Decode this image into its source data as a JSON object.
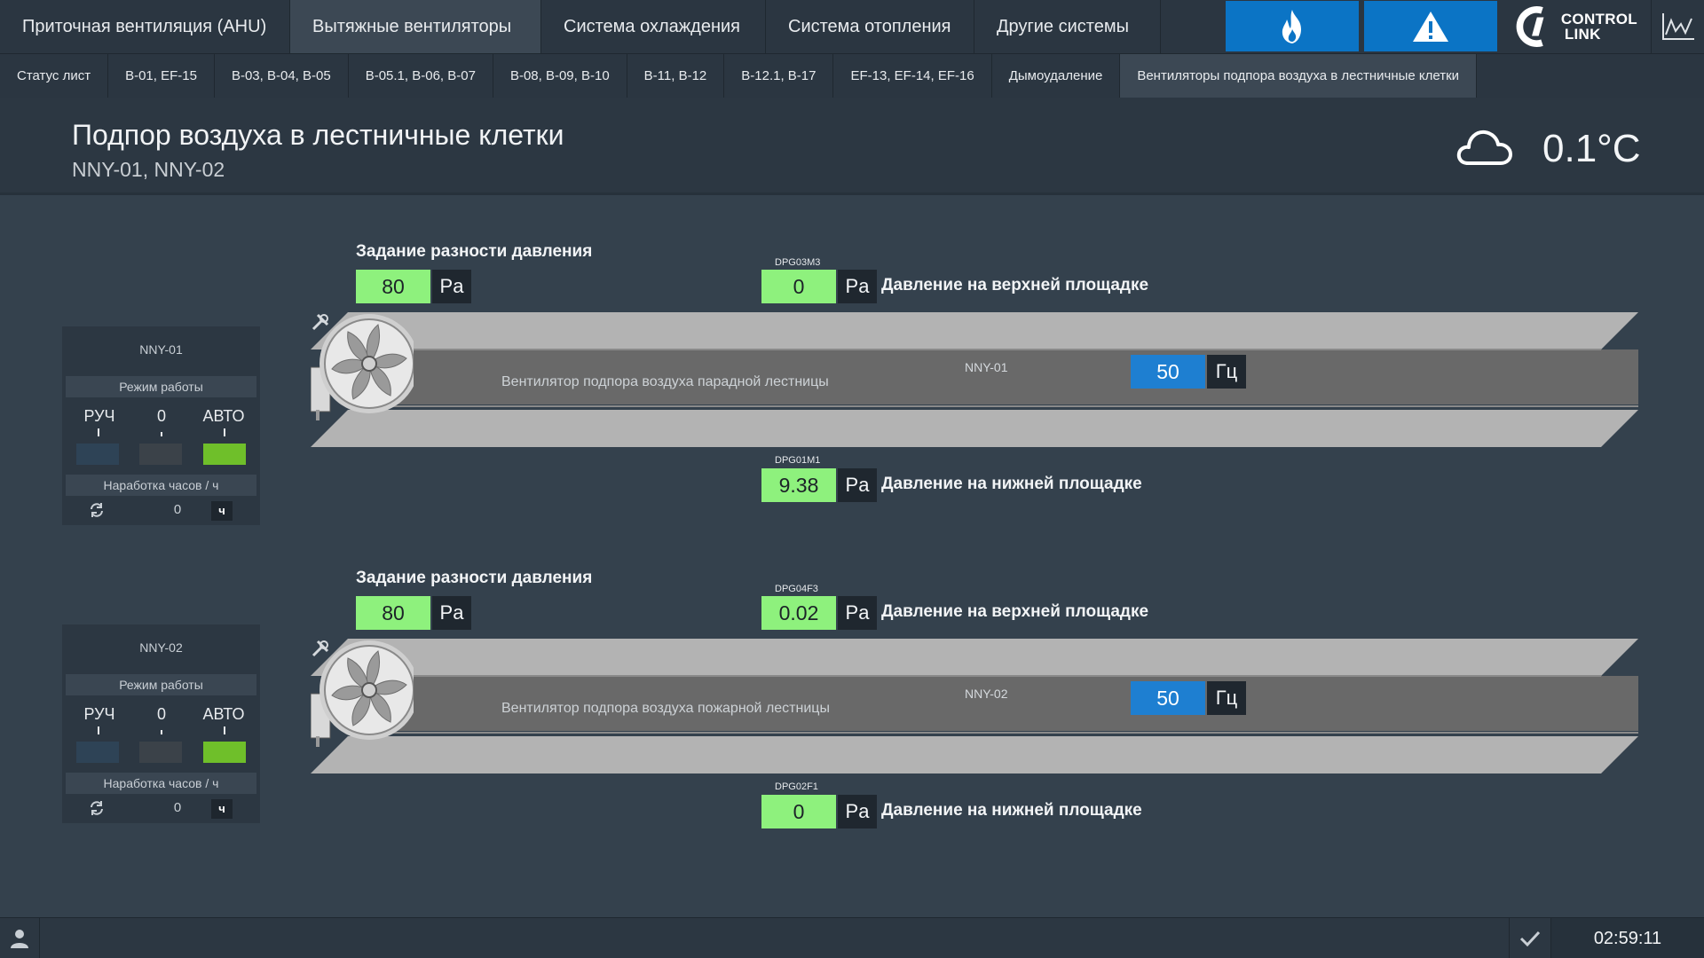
{
  "topnav": {
    "tabs": [
      {
        "label": "Приточная вентиляция (AHU)"
      },
      {
        "label": "Вытяжные вентиляторы"
      },
      {
        "label": "Система охлаждения"
      },
      {
        "label": "Система отопления"
      },
      {
        "label": "Другие системы"
      }
    ],
    "active_tab": 1,
    "fire_icon": "flame-icon",
    "alarm_icon": "warning-icon",
    "trend_icon": "trend-chart-icon",
    "logo_line1": "CONTROL",
    "logo_line2": "LINK"
  },
  "subnav": {
    "tabs": [
      {
        "label": "Статус лист"
      },
      {
        "label": "B-01, EF-15"
      },
      {
        "label": "B-03, B-04, B-05"
      },
      {
        "label": "B-05.1, B-06, B-07"
      },
      {
        "label": "B-08, B-09, B-10"
      },
      {
        "label": "B-11, B-12"
      },
      {
        "label": "B-12.1, B-17"
      },
      {
        "label": "EF-13, EF-14, EF-16"
      },
      {
        "label": "Дымоудаление"
      },
      {
        "label": "Вентиляторы подпора воздуха в лестничные клетки"
      }
    ],
    "active_tab": 9
  },
  "header": {
    "title": "Подпор воздуха в лестничные клетки",
    "subtitle": "NNY-01, NNY-02",
    "weather_icon": "cloud-icon",
    "outdoor_temp": "0.1°C"
  },
  "units": [
    {
      "name": "NNY-01",
      "mode_title": "Режим работы",
      "mode_manual": "РУЧ",
      "mode_off": "0",
      "mode_auto": "АВТО",
      "active_mode": "auto",
      "hours_title": "Наработка часов / ч",
      "hours_value": "0",
      "hours_unit": "ч",
      "setpoint_label": "Задание разности давления",
      "setpoint_value": "80",
      "setpoint_unit": "Pa",
      "upper_tag": "DPG03M3",
      "upper_value": "0",
      "upper_unit": "Pa",
      "upper_label": "Давление на верхней площадке",
      "duct_desc": "Вентилятор подпора воздуха парадной лестницы",
      "fan_tag": "NNY-01",
      "freq_value": "50",
      "freq_unit": "Гц",
      "lower_tag": "DPG01M1",
      "lower_value": "9.38",
      "lower_unit": "Pa",
      "lower_label": "Давление на нижней площадке"
    },
    {
      "name": "NNY-02",
      "mode_title": "Режим работы",
      "mode_manual": "РУЧ",
      "mode_off": "0",
      "mode_auto": "АВТО",
      "active_mode": "auto",
      "hours_title": "Наработка часов / ч",
      "hours_value": "0",
      "hours_unit": "ч",
      "setpoint_label": "Задание разности давления",
      "setpoint_value": "80",
      "setpoint_unit": "Pa",
      "upper_tag": "DPG04F3",
      "upper_value": "0.02",
      "upper_unit": "Pa",
      "upper_label": "Давление на верхней площадке",
      "duct_desc": "Вентилятор подпора воздуха пожарной лестницы",
      "fan_tag": "NNY-02",
      "freq_value": "50",
      "freq_unit": "Гц",
      "lower_tag": "DPG02F1",
      "lower_value": "0",
      "lower_unit": "Pa",
      "lower_label": "Давление на нижней площадке"
    }
  ],
  "colors": {
    "background": "#34414d",
    "accent_blue": "#0b74c5",
    "value_green": "#8ef17d",
    "mode_active_green": "#6fbf2a",
    "mode_manual_off": "#2e4356",
    "mode_zero_off": "#3b4249"
  },
  "statusbar": {
    "user_icon": "user-icon",
    "ack_icon": "checkmark-icon",
    "clock": "02:59:11"
  }
}
